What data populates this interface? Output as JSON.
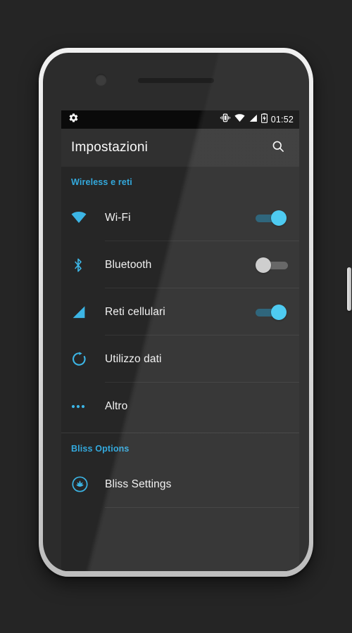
{
  "device": {
    "frame_color": "#e2e2e2",
    "body_color": "#2c2c2c",
    "hardware": {
      "earpiece": "earpiece-speaker",
      "front_camera": "front-camera",
      "volume_button": "volume-button",
      "power_button": "power-button"
    }
  },
  "status_bar": {
    "background": "#0a0a0a",
    "left_icons": [
      "gear-icon"
    ],
    "right_icons": [
      "vibrate-icon",
      "wifi-icon",
      "cellular-signal-icon",
      "battery-charging-icon"
    ],
    "time": "01:52"
  },
  "app_bar": {
    "title": "Impostazioni",
    "background": "#303030",
    "search_icon": "search-icon"
  },
  "accent_color": "#33a9dd",
  "sections": [
    {
      "header": "Wireless e reti",
      "items": [
        {
          "label": "Wi-Fi",
          "icon": "wifi-icon",
          "control": "switch",
          "state": "on"
        },
        {
          "label": "Bluetooth",
          "icon": "bluetooth-icon",
          "control": "switch",
          "state": "off"
        },
        {
          "label": "Reti cellulari",
          "icon": "cellular-signal-icon",
          "control": "switch",
          "state": "on"
        },
        {
          "label": "Utilizzo dati",
          "icon": "data-usage-icon",
          "control": "none",
          "state": ""
        },
        {
          "label": "Altro",
          "icon": "more-dots-icon",
          "control": "none",
          "state": ""
        }
      ]
    },
    {
      "header": "Bliss Options",
      "items": [
        {
          "label": "Bliss Settings",
          "icon": "bliss-lotus-icon",
          "control": "none",
          "state": ""
        }
      ]
    }
  ]
}
